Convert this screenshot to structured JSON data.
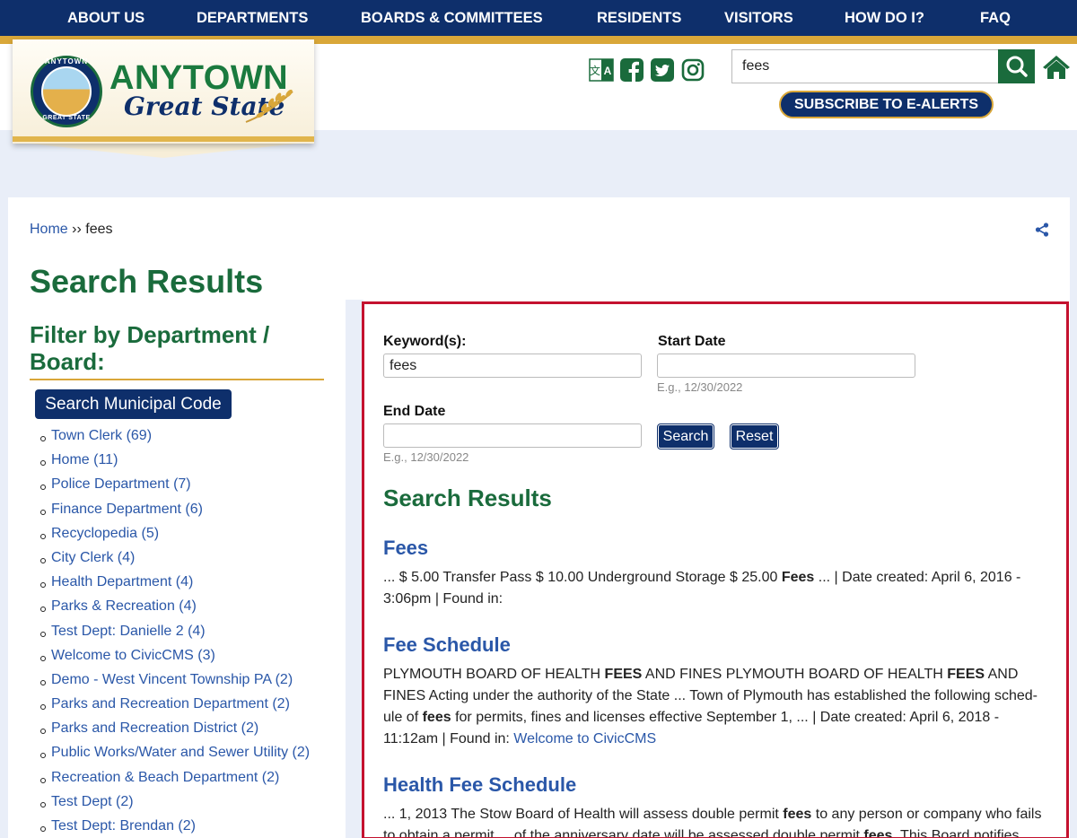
{
  "nav": {
    "items": [
      "ABOUT US",
      "DEPARTMENTS",
      "BOARDS & COMMITTEES",
      "RESIDENTS",
      "VISITORS",
      "HOW DO I?",
      "FAQ"
    ]
  },
  "brand": {
    "name": "ANYTOWN",
    "subtitle": "Great State",
    "seal_top": "ANYTOWN",
    "seal_bottom": "GREAT STATE"
  },
  "header": {
    "search_value": "fees",
    "subscribe_label": "SUBSCRIBE TO E-ALERTS",
    "social_icons": [
      "translate-icon",
      "facebook-icon",
      "twitter-icon",
      "instagram-icon"
    ]
  },
  "breadcrumb": {
    "home": "Home",
    "separator": "››",
    "current": "fees"
  },
  "page_title": "Search Results",
  "filter": {
    "title": "Filter by Department / Board:",
    "municipal_code_label": "Search Municipal Code",
    "departments": [
      "Town Clerk (69)",
      "Home (11)",
      "Police Department (7)",
      "Finance Department (6)",
      "Recyclopedia (5)",
      "City Clerk (4)",
      "Health Department (4)",
      "Parks & Recreation (4)",
      "Test Dept: Danielle 2 (4)",
      "Welcome to CivicCMS (3)",
      "Demo - West Vincent Township PA (2)",
      "Parks and Recreation Department (2)",
      "Parks and Recreation District (2)",
      "Public Works/Water and Sewer Utility (2)",
      "Recreation & Beach Department (2)",
      "Test Dept (2)",
      "Test Dept: Brendan (2)"
    ]
  },
  "form": {
    "keyword_label": "Keyword(s):",
    "keyword_value": "fees",
    "start_label": "Start Date",
    "start_hint": "E.g., 12/30/2022",
    "end_label": "End Date",
    "end_hint": "E.g., 12/30/2022",
    "search_label": "Search",
    "reset_label": "Reset"
  },
  "results": {
    "heading": "Search Results",
    "items": [
      {
        "title": "Fees",
        "snippet_lines": [
          "... $ 5.00 Transfer Pass $ 10.00 Underground Storage $ 25.00 <b>Fees</b> ... | Date created: April 6, 2016 -",
          "3:06pm | Found in:"
        ]
      },
      {
        "title": "Fee Schedule",
        "snippet_lines": [
          "PLYMOUTH BOARD OF HEALTH <b>FEES</b> AND FINES PLYMOUTH BOARD OF HEALTH <b>FEES</b> AND",
          "FINES Acting under the authority of the State ... Town of Plymouth has established the following sched-",
          "ule of <b>fees</b> for permits, fines and licenses effective September 1, ... | Date created: April 6, 2018 -",
          "11:12am | Found in: <a>Welcome to CivicCMS</a>"
        ]
      },
      {
        "title": "Health Fee Schedule",
        "snippet_lines": [
          "... 1, 2013 The Stow Board of Health will assess double permit <b>fees</b> to any person or company who fails",
          "to obtain a permit ... of the anniversary date will be assessed double permit <b>fees</b>. This Board notifies"
        ]
      }
    ]
  }
}
